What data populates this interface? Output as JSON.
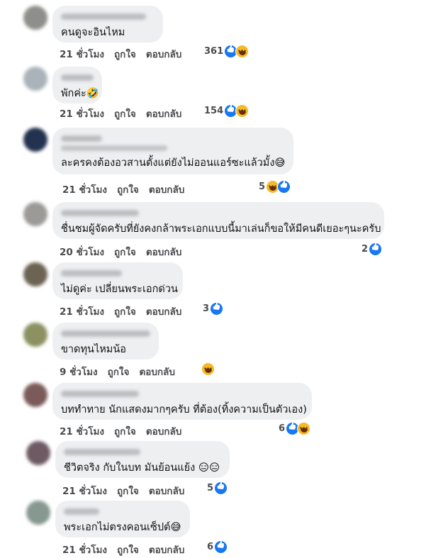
{
  "ui": {
    "like_label": "ถูกใจ",
    "reply_label": "ตอบกลับ"
  },
  "colors": {
    "bubble": "#eeeff1",
    "like_blue": "#1877f2",
    "haha_yellow": "#f7b928"
  },
  "comments": [
    {
      "text": "คนดูจะอินไหม",
      "time": "21 ชั่วโมง",
      "count": "361",
      "icons": [
        "like-icon",
        "haha-icon"
      ]
    },
    {
      "text": "พักค่ะ🤣",
      "time": "21 ชั่วโมง",
      "count": "154",
      "icons": [
        "like-icon",
        "haha-icon"
      ]
    },
    {
      "text": "ละครคงต้องอวสานตั้งแต่ยังไม่ออนแอร์ซะแล้วมั้ง😅",
      "time": "21 ชั่วโมง",
      "count": "5",
      "icons": [
        "haha-icon",
        "like-icon"
      ]
    },
    {
      "text": "ชื่นชมผู้จัดครับที่ยังคงกล้าพระเอกแบบนี้มาเล่นก็ขอให้มีคนดีเยอะๆนะครับ",
      "time": "20 ชั่วโมง",
      "count": "2",
      "icons": [
        "like-icon"
      ]
    },
    {
      "text": "ไม่ดูค่ะ เปลี่ยนพระเอกด่วน",
      "time": "21 ชั่วโมง",
      "count": "3",
      "icons": [
        "like-icon"
      ]
    },
    {
      "text": "ขาดทุนไหมน้อ",
      "time": "9 ชั่วโมง",
      "count": "",
      "icons": [
        "haha-icon"
      ]
    },
    {
      "text": "บททำทาย นักแสดงมากๆครับ ที่ต้อง(ทิ้งความเป็นตัวเอง)",
      "time": "21 ชั่วโมง",
      "count": "6",
      "icons": [
        "like-icon",
        "haha-icon"
      ]
    },
    {
      "text": "ชีวิตจริง กับในบท มันย้อนแย้ง 😑😑",
      "time": "21 ชั่วโมง",
      "count": "5",
      "icons": [
        "like-icon"
      ]
    },
    {
      "text": "พระเอกไม่ตรงคอนเซ็ปต์😅",
      "time": "21 ชั่วโมง",
      "count": "6",
      "icons": [
        "like-icon"
      ]
    }
  ]
}
